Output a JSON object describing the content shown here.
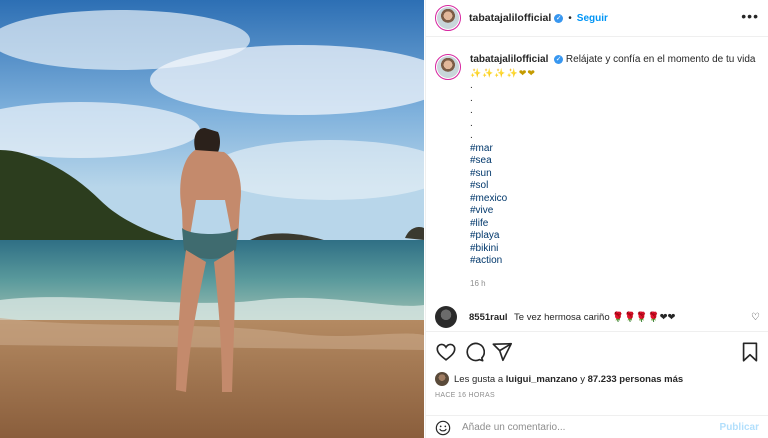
{
  "post": {
    "username": "tabatajalilofficial",
    "follow_label": "Seguir",
    "more_label": "•••"
  },
  "caption": {
    "username": "tabatajalilofficial",
    "text": "Relájate y confía en el momento de tu vida",
    "emojis": "✨✨✨✨",
    "hearts": "❤❤",
    "dots": [
      ".",
      ".",
      ".",
      ".",
      "."
    ],
    "hashtags": [
      "#mar",
      "#sea",
      "#sun",
      "#sol",
      "#mexico",
      "#vive",
      "#life",
      "#playa",
      "#bikini",
      "#action"
    ],
    "time": "16 h"
  },
  "comment": {
    "username": "8551raul",
    "text": "Te vez hermosa cariño",
    "emojis": "🌹🌹🌹🌹❤❤"
  },
  "likes": {
    "prefix": "Les gusta a",
    "user": "luigui_manzano",
    "joiner": "y",
    "count": "87.233 personas más"
  },
  "ago": "HACE 16 HORAS",
  "add_comment": {
    "placeholder": "Añade un comentario...",
    "publish_label": "Publicar"
  },
  "colors": {
    "link": "#0095f6",
    "hashtag": "#00376b",
    "muted": "#8e8e8e"
  }
}
